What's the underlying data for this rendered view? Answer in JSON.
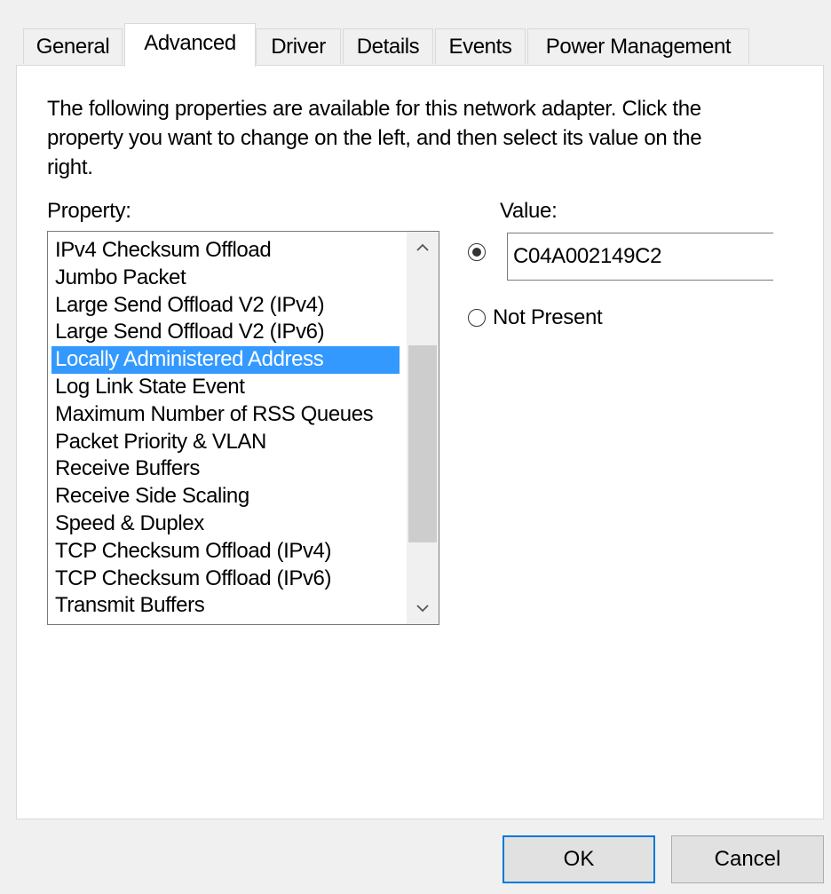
{
  "tabs": [
    {
      "label": "General",
      "active": false
    },
    {
      "label": "Advanced",
      "active": true
    },
    {
      "label": "Driver",
      "active": false
    },
    {
      "label": "Details",
      "active": false
    },
    {
      "label": "Events",
      "active": false
    },
    {
      "label": "Power Management",
      "active": false
    }
  ],
  "advanced": {
    "description": "The following properties are available for this network adapter. Click the property you want to change on the left, and then select its value on the right.",
    "property_label": "Property:",
    "value_label": "Value:",
    "properties": [
      "IPv4 Checksum Offload",
      "Jumbo Packet",
      "Large Send Offload V2 (IPv4)",
      "Large Send Offload V2 (IPv6)",
      "Locally Administered Address",
      "Log Link State Event",
      "Maximum Number of RSS Queues",
      "Packet Priority & VLAN",
      "Receive Buffers",
      "Receive Side Scaling",
      "Speed & Duplex",
      "TCP Checksum Offload (IPv4)",
      "TCP Checksum Offload (IPv6)",
      "Transmit Buffers"
    ],
    "selected_property": "Locally Administered Address",
    "value_text": "C04A002149C2",
    "value_option_selected": true,
    "not_present_label": "Not Present",
    "not_present_selected": false
  },
  "buttons": {
    "ok": "OK",
    "cancel": "Cancel"
  },
  "colors": {
    "selection": "#3399ff",
    "default_button_border": "#0078d7",
    "panel_background": "#ffffff",
    "window_background": "#f0f0f0"
  }
}
